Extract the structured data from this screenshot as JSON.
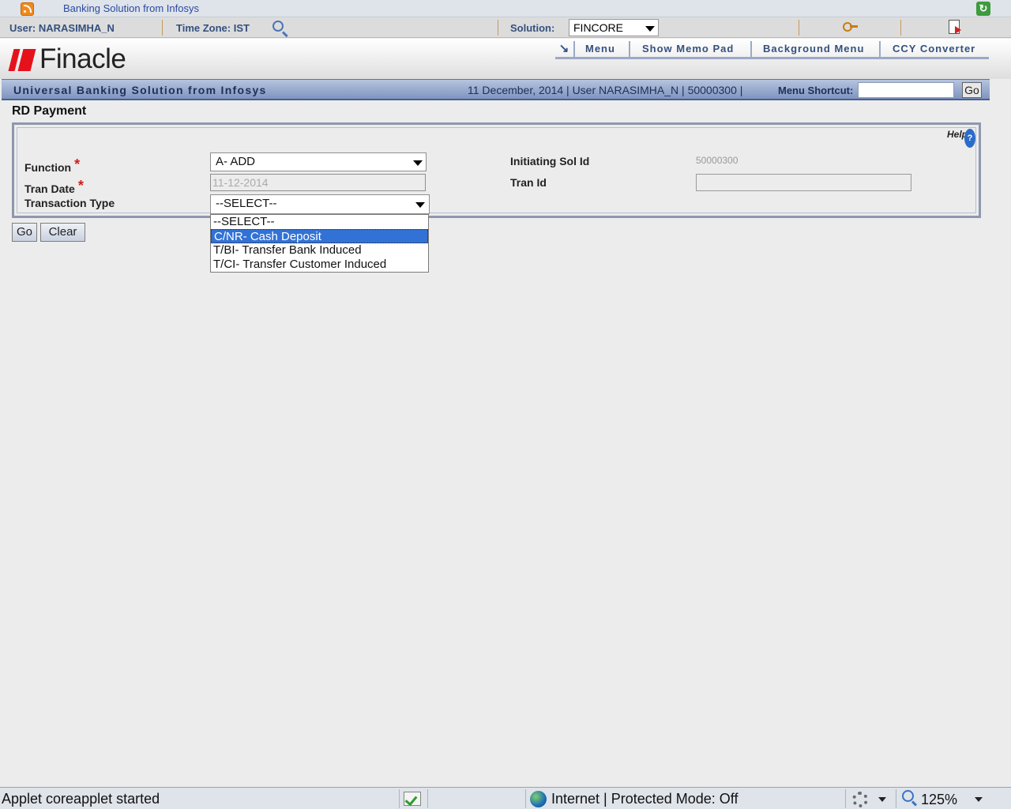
{
  "browser": {
    "tab_title": "Banking Solution from Infosys"
  },
  "userbar": {
    "user": "User: NARASIMHA_N",
    "timezone": "Time Zone:  IST",
    "solution_label": "Solution:",
    "solution_value": "FINCORE"
  },
  "header": {
    "logo_text": "Finacle",
    "menu_items": [
      "Menu",
      "Show Memo Pad",
      "Background Menu",
      "CCY Converter"
    ],
    "tagline": "Universal Banking Solution from Infosys",
    "session_info": "11 December, 2014  |  User  NARASIMHA_N  |  50000300  |",
    "shortcut_label": "Menu Shortcut:",
    "shortcut_value": "",
    "shortcut_go": "Go"
  },
  "page": {
    "title": "RD Payment",
    "help_label": "Help",
    "help_symbol": "?"
  },
  "form": {
    "function_label": "Function",
    "function_value": "A- ADD",
    "tran_date_label": "Tran Date",
    "tran_date_value": "11-12-2014",
    "transaction_type_label": "Transaction Type",
    "transaction_type_value": "--SELECT--",
    "required_mark": "*",
    "initiating_sol_label": "Initiating Sol Id",
    "initiating_sol_value": "50000300",
    "tran_id_label": "Tran Id",
    "tran_id_value": ""
  },
  "dropdown": {
    "options": [
      "--SELECT--",
      "C/NR- Cash Deposit",
      "T/BI- Transfer Bank Induced",
      "T/CI- Transfer Customer Induced"
    ],
    "highlighted_index": 1
  },
  "buttons": {
    "go": "Go",
    "clear": "Clear"
  },
  "statusbar": {
    "status": "Applet coreapplet started",
    "zone": "Internet | Protected Mode: Off",
    "zoom": "125%"
  }
}
